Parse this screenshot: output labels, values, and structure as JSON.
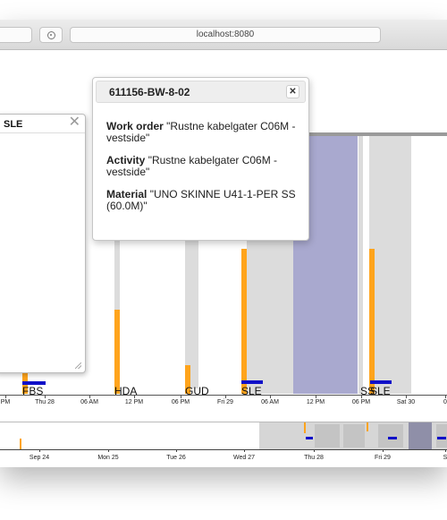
{
  "browser": {
    "url": "localhost:8080"
  },
  "popup": {
    "title": "611156-BW-8-02",
    "close_label": "✕",
    "rows": [
      {
        "label": "Work order",
        "value": "\"Rustne kabelgater C06M - vestside\""
      },
      {
        "label": "Activity",
        "value": "\"Rustne kabelgater C06M - vestside\""
      },
      {
        "label": "Material",
        "value": "\"UNO SKINNE U41-1-PER SS (60.0M)\""
      }
    ]
  },
  "side_panel": {
    "title": "SLE",
    "close_label": "✕"
  },
  "timeline": {
    "locations": [
      "FBS",
      "HDA",
      "GUD",
      "SLE",
      "SS",
      "SLE"
    ],
    "axis_labels": [
      "PM",
      "Thu 28",
      "06 AM",
      "12 PM",
      "06 PM",
      "Fri 29",
      "06 AM",
      "12 PM",
      "06 PM",
      "Sat 30",
      "0"
    ],
    "colors": {
      "band": "#dcdcdc",
      "highlight": "#a9a9cf",
      "bar": "#ffa41c",
      "tick": "#1010c8"
    }
  },
  "overview": {
    "axis_labels": [
      "Sep 24",
      "Mon 25",
      "Tue 26",
      "Wed 27",
      "Thu 28",
      "Fri 29",
      "S"
    ]
  }
}
